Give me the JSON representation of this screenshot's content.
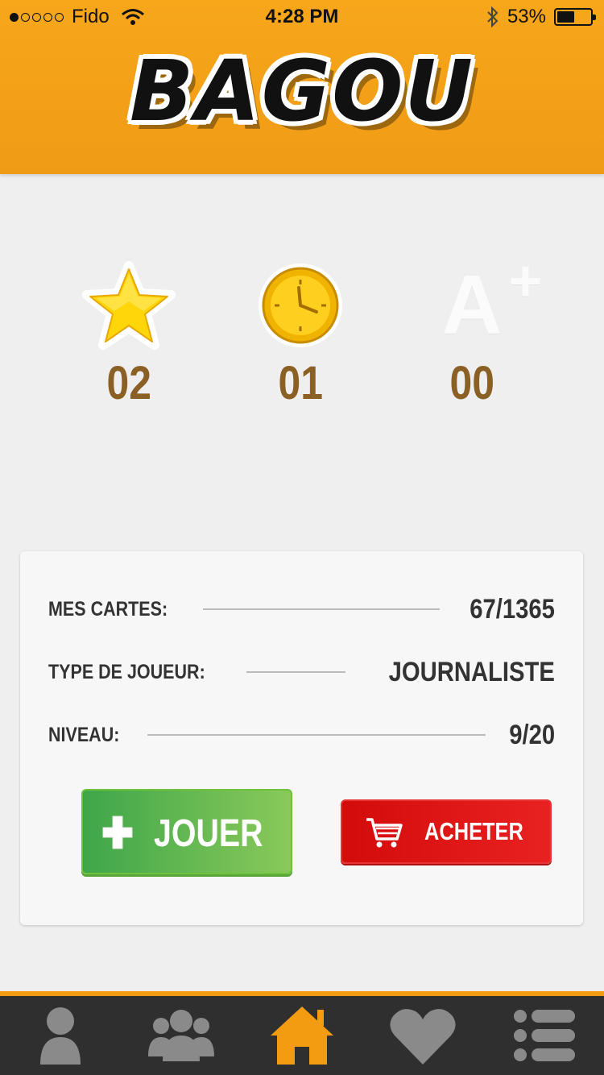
{
  "status_bar": {
    "carrier": "Fido",
    "time": "4:28 PM",
    "battery": "53%",
    "battery_level": 0.53,
    "signal_bars": 1
  },
  "header": {
    "logo_text": "BAGOU",
    "color": "#f39c12"
  },
  "stats": [
    {
      "icon": "star-icon",
      "value": "02"
    },
    {
      "icon": "clock-icon",
      "value": "01"
    },
    {
      "icon": "a-plus-icon",
      "icon_text": "A",
      "icon_sup": "+",
      "value": "00"
    }
  ],
  "info": {
    "cards_label": "MES CARTES:",
    "cards_value": "67/1365",
    "type_label": "TYPE DE JOUEUR:",
    "type_value": "JOURNALISTE",
    "level_label": "NIVEAU:",
    "level_value": "9/20"
  },
  "buttons": {
    "play_label": "JOUER",
    "buy_label": "ACHETER"
  },
  "tabbar": {
    "items": [
      {
        "icon": "user-icon",
        "active": false
      },
      {
        "icon": "group-icon",
        "active": false
      },
      {
        "icon": "home-icon",
        "active": true
      },
      {
        "icon": "heart-icon",
        "active": false
      },
      {
        "icon": "list-icon",
        "active": false
      }
    ],
    "active_color": "#f39c12",
    "inactive_color": "#8a8a8a"
  }
}
